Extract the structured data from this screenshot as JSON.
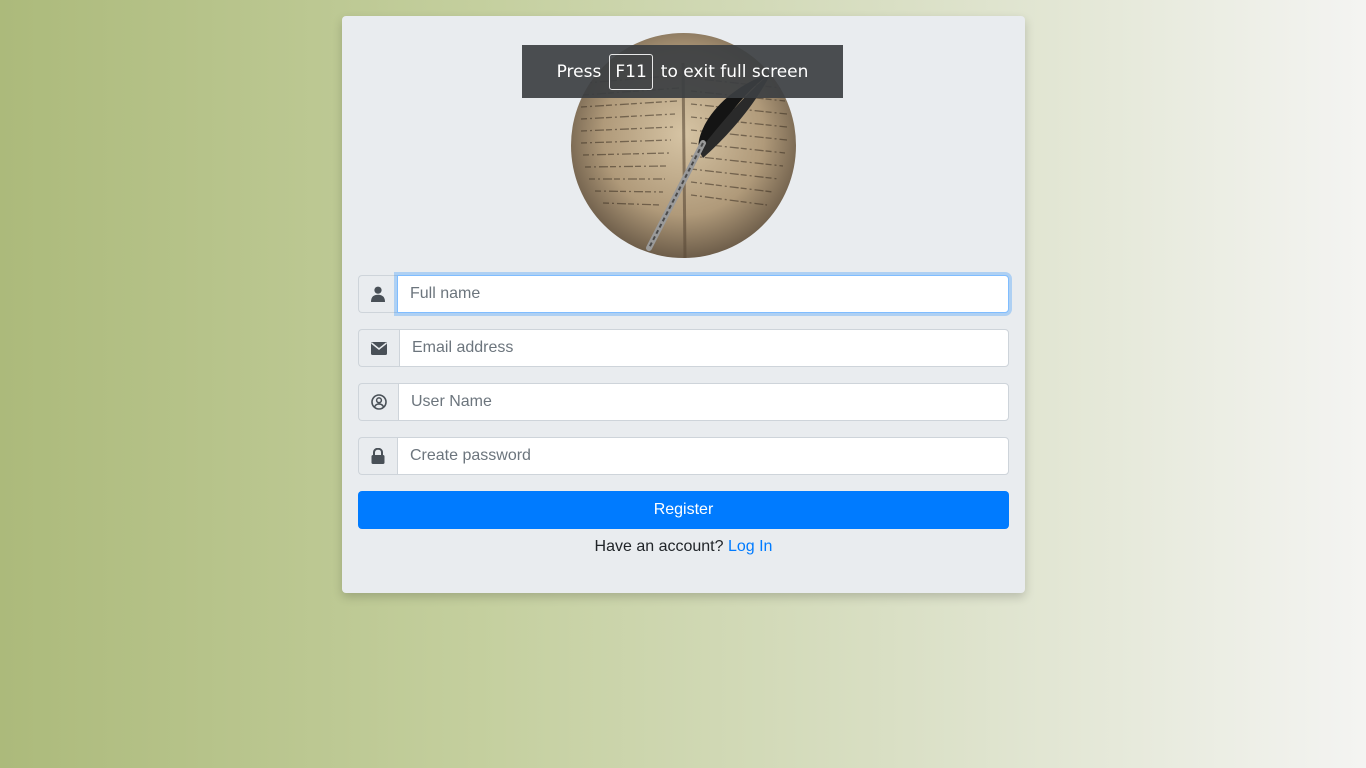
{
  "fullscreen_notice": {
    "prefix": "Press",
    "key": "F11",
    "suffix": "to exit full screen"
  },
  "form": {
    "avatar_icon": "quill-on-manuscript-image",
    "fields": [
      {
        "icon": "user-icon",
        "placeholder": "Full name",
        "value": ""
      },
      {
        "icon": "envelope-icon",
        "placeholder": "Email address",
        "value": ""
      },
      {
        "icon": "user-circle-icon",
        "placeholder": "User Name",
        "value": ""
      },
      {
        "icon": "lock-icon",
        "placeholder": "Create password",
        "value": ""
      }
    ],
    "register_label": "Register",
    "account_prompt": "Have an account?",
    "login_label": "Log In"
  },
  "colors": {
    "accent": "#007bff",
    "card_bg": "#e9ecef",
    "focus_ring": "#80bdff"
  }
}
